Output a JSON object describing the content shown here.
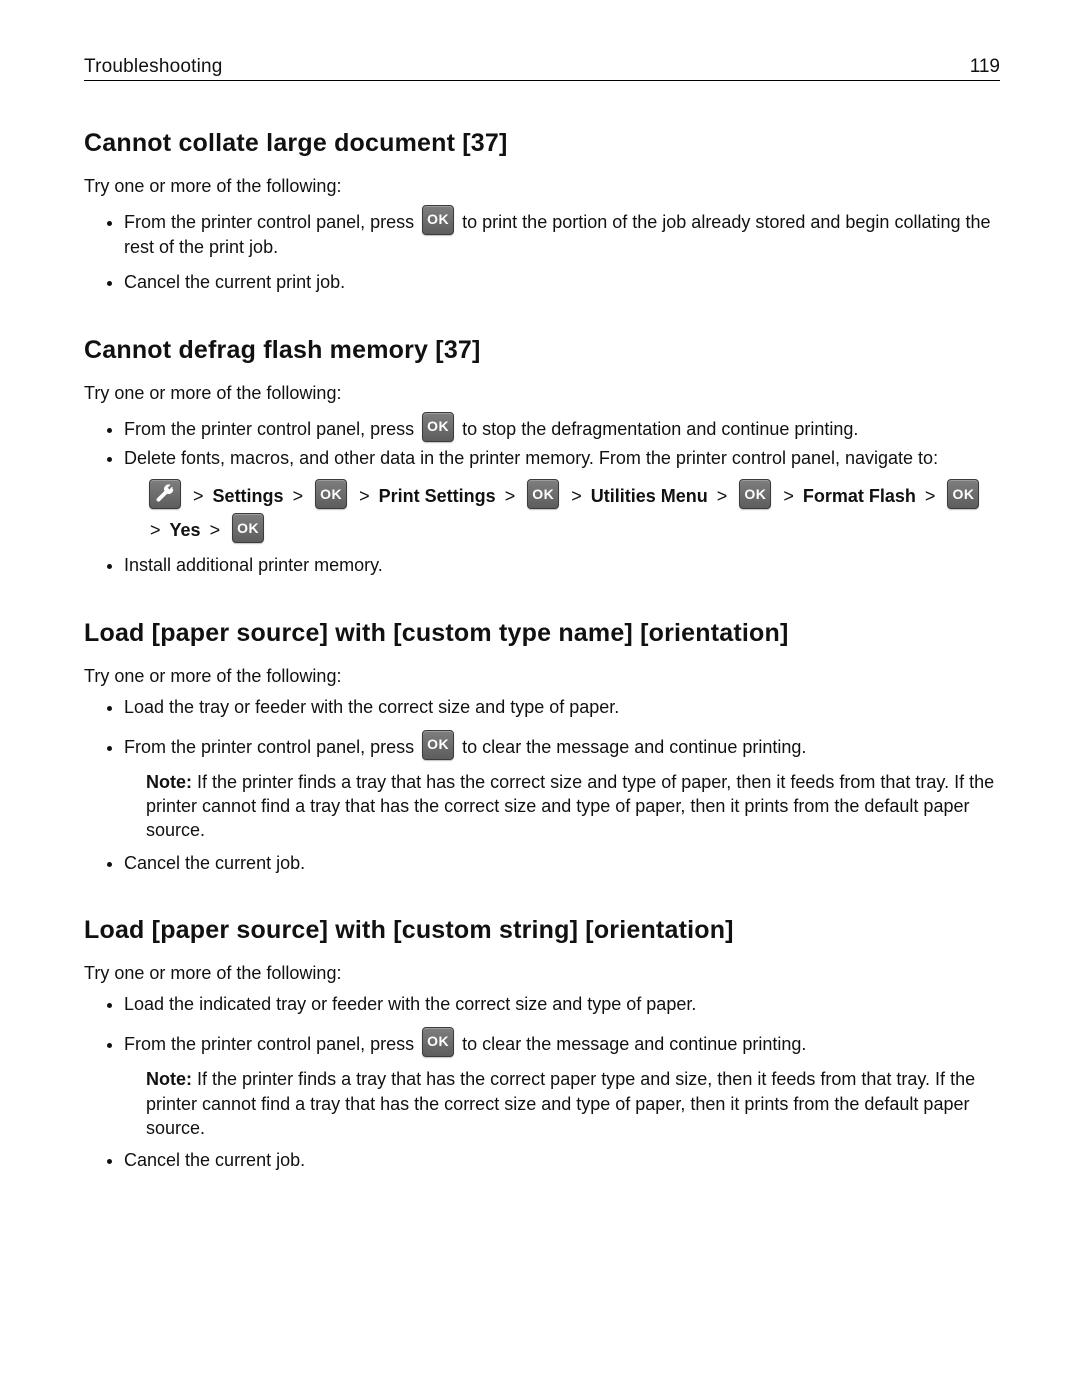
{
  "header": {
    "section": "Troubleshooting",
    "page_number": "119"
  },
  "common": {
    "try_intro": "Try one or more of the following:",
    "from_panel_press": "From the printer control panel, press ",
    "gt": ">",
    "note_label": "Note:"
  },
  "s1": {
    "title": "Cannot collate large document [37]",
    "b1_after": " to print the portion of the job already stored and begin collating the rest of the print job.",
    "b2": "Cancel the current print job."
  },
  "s2": {
    "title": "Cannot defrag flash memory [37]",
    "b1_after": " to stop the defragmentation and continue printing.",
    "b2": "Delete fonts, macros, and other data in the printer memory. From the printer control panel, navigate to:",
    "path": {
      "settings": "Settings",
      "print_settings": "Print Settings",
      "utilities_menu": "Utilities Menu",
      "format_flash": "Format Flash",
      "yes": "Yes"
    },
    "b3": "Install additional printer memory."
  },
  "s3": {
    "title": "Load [paper source] with [custom type name] [orientation]",
    "b1": "Load the tray or feeder with the correct size and type of paper.",
    "b2_after": " to clear the message and continue printing.",
    "note_text": " If the printer finds a tray that has the correct size and type of paper, then it feeds from that tray. If the printer cannot find a tray that has the correct size and type of paper, then it prints from the default paper source.",
    "b3": "Cancel the current job."
  },
  "s4": {
    "title": "Load [paper source] with [custom string] [orientation]",
    "b1": "Load the indicated tray or feeder with the correct size and type of paper.",
    "b2_after": " to clear the message and continue printing.",
    "note_text": " If the printer finds a tray that has the correct paper type and size, then it feeds from that tray. If the printer cannot find a tray that has the correct size and type of paper, then it prints from the default paper source.",
    "b3": "Cancel the current job."
  }
}
